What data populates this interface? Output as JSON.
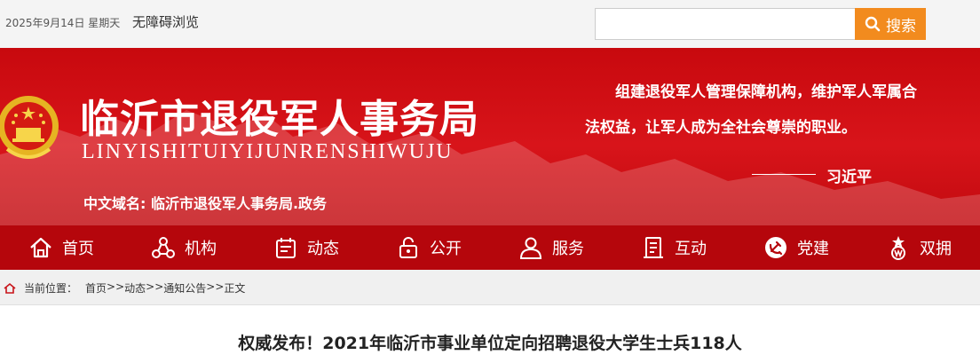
{
  "topbar": {
    "date": "2025年9月14日 星期天",
    "accessibility": "无障碍浏览",
    "search_placeholder": "",
    "search_label": "搜索"
  },
  "banner": {
    "title": "临沂市退役军人事务局",
    "pinyin": "LINYISHITUIYIJUNRENSHIWUJU",
    "domain": "中文域名: 临沂市退役军人事务局.政务",
    "quote": "组建退役军人管理保障机构，维护军人军属合法权益，让军人成为全社会尊崇的职业。",
    "author": "习近平"
  },
  "nav": {
    "items": [
      {
        "label": "首页",
        "icon": "home-icon"
      },
      {
        "label": "机构",
        "icon": "organization-icon"
      },
      {
        "label": "动态",
        "icon": "news-icon"
      },
      {
        "label": "公开",
        "icon": "lock-icon"
      },
      {
        "label": "服务",
        "icon": "user-icon"
      },
      {
        "label": "互动",
        "icon": "document-icon"
      },
      {
        "label": "党建",
        "icon": "party-icon"
      },
      {
        "label": "双拥",
        "icon": "army-star-icon"
      }
    ]
  },
  "breadcrumb": {
    "label": "当前位置：",
    "items": [
      "首页",
      "动态",
      "通知公告",
      "正文"
    ],
    "separator": ">>"
  },
  "article": {
    "title": "权威发布！2021年临沂市事业单位定向招聘退役大学生士兵118人"
  },
  "colors": {
    "banner_red": "#d8141a",
    "nav_red": "#b5060c",
    "search_orange": "#f28b1e"
  }
}
